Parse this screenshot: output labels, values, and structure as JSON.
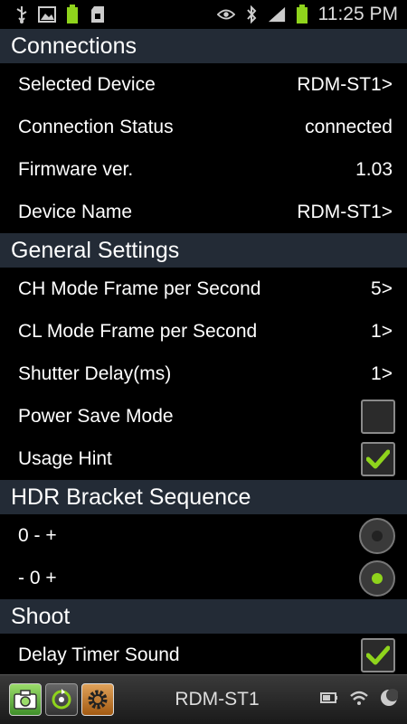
{
  "status_bar": {
    "time": "11:25 PM",
    "left_icons": [
      "usb-icon",
      "image-icon",
      "battery-app-icon",
      "sd-card-icon"
    ],
    "right_icons": [
      "eye-icon",
      "bluetooth-icon",
      "signal-icon",
      "battery-icon"
    ]
  },
  "connections": {
    "title": "Connections",
    "rows": [
      {
        "label": "Selected Device",
        "value": "RDM-ST1>"
      },
      {
        "label": "Connection Status",
        "value": "connected"
      },
      {
        "label": "Firmware ver.",
        "value": "1.03"
      },
      {
        "label": "Device Name",
        "value": "RDM-ST1>"
      }
    ]
  },
  "general": {
    "title": "General Settings",
    "rows": [
      {
        "label": "CH Mode Frame per Second",
        "value": "5>"
      },
      {
        "label": "CL Mode Frame per Second",
        "value": "1>"
      },
      {
        "label": "Shutter Delay(ms)",
        "value": "1>"
      }
    ],
    "power_save_label": "Power Save Mode",
    "power_save_checked": false,
    "usage_hint_label": "Usage Hint",
    "usage_hint_checked": true
  },
  "hdr": {
    "title": "HDR Bracket Sequence",
    "options": [
      {
        "label": "0 - +",
        "selected": false
      },
      {
        "label": "- 0 +",
        "selected": true
      }
    ]
  },
  "shoot": {
    "title": "Shoot",
    "delay_timer_sound_label": "Delay Timer Sound",
    "delay_timer_sound_checked": true
  },
  "bottom_bar": {
    "title": "RDM-ST1",
    "buttons": [
      "camera-icon",
      "sequence-icon",
      "gear-icon"
    ],
    "right_icons": [
      "battery-icon",
      "wifi-icon",
      "moon-icon"
    ]
  },
  "colors": {
    "accent": "#8fd41c",
    "section_header_bg": "#232b36",
    "background": "#000000"
  }
}
